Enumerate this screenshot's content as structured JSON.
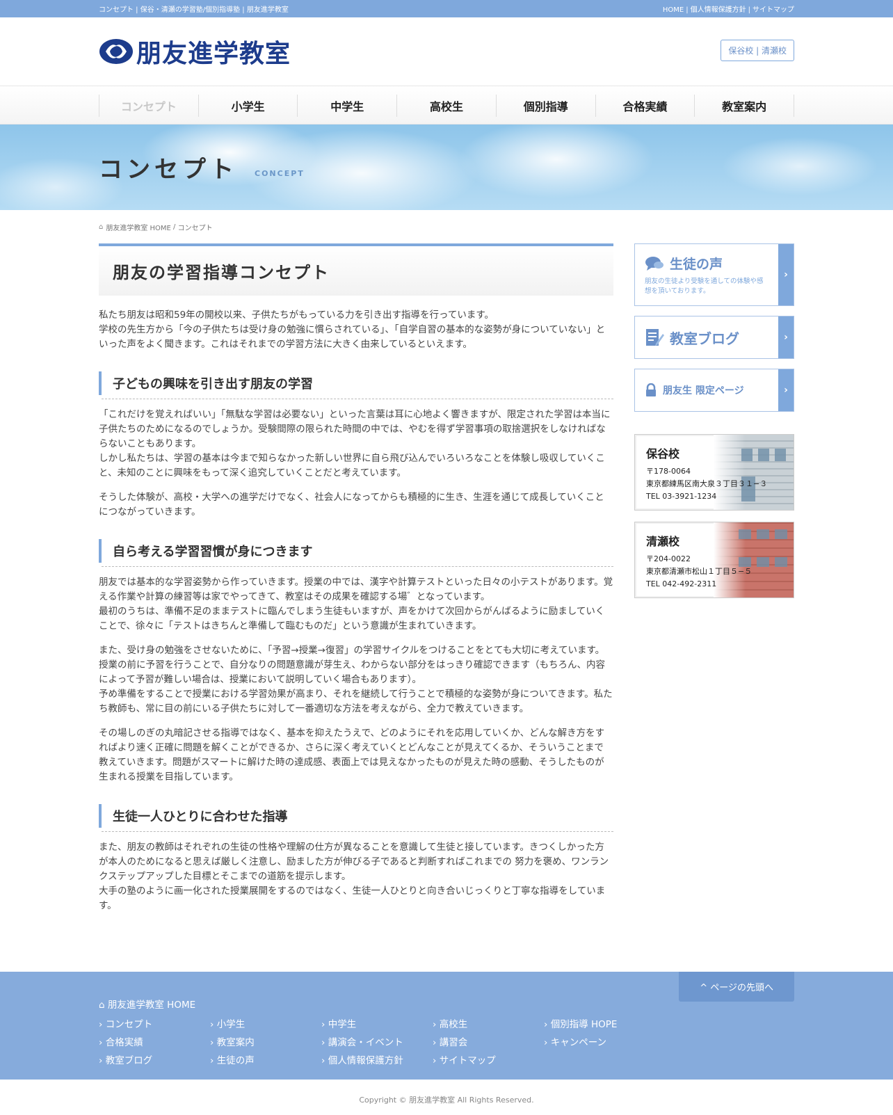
{
  "topbar": {
    "tagline": "コンセプト | 保谷・清瀬の学習塾/個別指導塾 | 朋友進学教室",
    "links": [
      "HOME",
      "個人情報保護方針",
      "サイトマップ"
    ]
  },
  "header": {
    "logo_text": "朋友進学教室",
    "school_links": "保谷校 | 清瀬校"
  },
  "nav": {
    "items": [
      "コンセプト",
      "小学生",
      "中学生",
      "高校生",
      "個別指導",
      "合格実績",
      "教室案内"
    ]
  },
  "hero": {
    "title": "コンセプト",
    "en": "CONCEPT"
  },
  "breadcrumb": {
    "home": "朋友進学教室 HOME",
    "sep": " / ",
    "current": "コンセプト"
  },
  "main": {
    "title": "朋友の学習指導コンセプト",
    "intro": [
      "私たち朋友は昭和59年の開校以来、子供たちがもっている力を引き出す指導を行っています。",
      "学校の先生方から「今の子供たちは受け身の勉強に慣らされている」、「自学自習の基本的な姿勢が身についていない」といった声をよく聞きます。これはそれまでの学習方法に大きく由来しているといえます。"
    ],
    "sections": [
      {
        "heading": "子どもの興味を引き出す朋友の学習",
        "paragraphs": [
          "「これだけを覚えればいい」「無駄な学習は必要ない」といった言葉は耳に心地よく響きますが、限定された学習は本当に子供たちのためになるのでしょうか。受験間際の限られた時間の中では、やむを得ず学習事項の取捨選択をしなければならないこともあります。",
          "しかし私たちは、学習の基本は今まで知らなかった新しい世界に自ら飛び込んでいろいろなことを体験し吸収していくこと、未知のことに興味をもって深く追究していくことだと考えています。",
          "そうした体験が、高校・大学への進学だけでなく、社会人になってからも積極的に生き、生涯を通じて成長していくことにつながっていきます。"
        ]
      },
      {
        "heading": "自ら考える学習習慣が身につきます",
        "paragraphs": [
          "朋友では基本的な学習姿勢から作っていきます。授業の中では、漢字や計算テストといった日々の小テストがあります。覚える作業や計算の練習等は家でやってきて、教室はその成果を確認する場゛となっています。",
          "最初のうちは、準備不足のままテストに臨んでしまう生徒もいますが、声をかけて次回からがんばるように励ましていくことで、徐々に「テストはきちんと準備して臨むものだ」という意識が生まれていきます。",
          "また、受け身の勉強をさせないために、「予習→授業→復習」の学習サイクルをつけることをとても大切に考えています。授業の前に予習を行うことで、自分なりの問題意識が芽生え、わからない部分をはっきり確認できます（もちろん、内容によって予習が難しい場合は、授業において説明していく場合もあります）。",
          "予め準備をすることで授業における学習効果が高まり、それを継続して行うことで積極的な姿勢が身についてきます。私たち教師も、常に目の前にいる子供たちに対して一番適切な方法を考えながら、全力で教えていきます。",
          "その場しのぎの丸暗記させる指導ではなく、基本を抑えたうえで、どのようにそれを応用していくか、どんな解き方をすればより速く正確に問題を解くことができるか、さらに深く考えていくとどんなことが見えてくるか、そういうことまで 教えていきます。問題がスマートに解けた時の達成感、表面上では見えなかったものが見えた時の感動、そうしたものが生まれる授業を目指しています。"
        ]
      },
      {
        "heading": "生徒一人ひとりに合わせた指導",
        "paragraphs": [
          "また、朋友の教師はそれぞれの生徒の性格や理解の仕方が異なることを意識して生徒と接しています。きつくしかった方が本人のためになると思えば厳しく注意し、励ました方が伸びる子であると判断すればこれまでの 努力を褒め、ワンランクステップアップした目標とそこまでの道筋を提示します。",
          "大手の塾のように画一化された授業展開をするのではなく、生徒一人ひとりと向き合いじっくりと丁寧な指導をしています。"
        ]
      }
    ]
  },
  "side": {
    "voice": {
      "title": "生徒の声",
      "desc": "朋友の生徒より受験を通しての体験や感想を頂いております。"
    },
    "blog": {
      "title": "教室ブログ"
    },
    "members": {
      "title": "朋友生 限定ページ"
    },
    "schools": [
      {
        "name": "保谷校",
        "zip": "〒178-0064",
        "address": "東京都練馬区南大泉３丁目３１−３",
        "tel": "TEL 03-3921-1234"
      },
      {
        "name": "清瀬校",
        "zip": "〒204-0022",
        "address": "東京都清瀬市松山１丁目５−５",
        "tel": "TEL 042-492-2311"
      }
    ]
  },
  "footer": {
    "pagetop": "ページの先頭へ",
    "home": "朋友進学教室 HOME",
    "links": [
      "コンセプト",
      "小学生",
      "中学生",
      "高校生",
      "個別指導 HOPE",
      "合格実績",
      "教室案内",
      "講演会・イベント",
      "講習会",
      "キャンペーン",
      "教室ブログ",
      "生徒の声",
      "個人情報保護方針",
      "サイトマップ"
    ],
    "copyright": "Copyright © 朋友進学教室 All Rights Reserved."
  },
  "colors": {
    "accent": "#7fa8dc",
    "logo": "#1d3c8c",
    "footer": "#86abdc"
  }
}
